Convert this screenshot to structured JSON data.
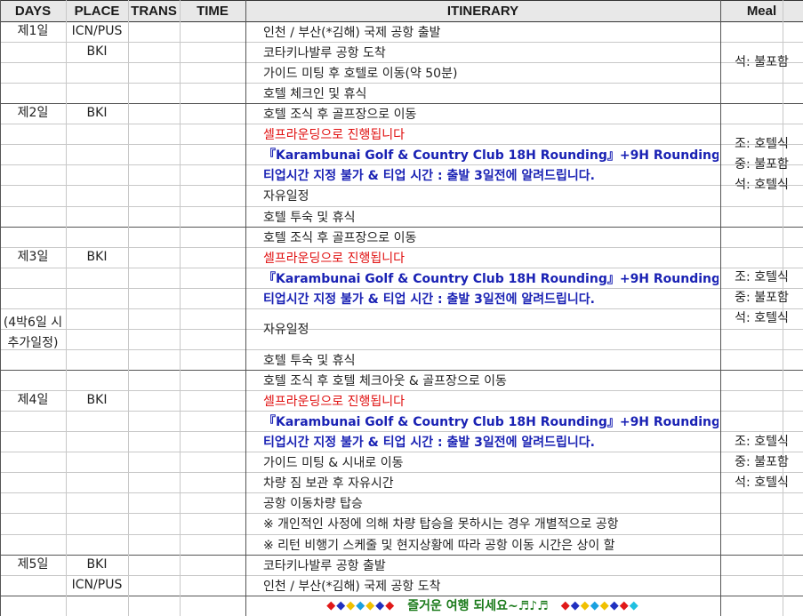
{
  "headers": {
    "days": "DAYS",
    "place": "PLACE",
    "trans": "TRANS",
    "time": "TIME",
    "itinerary": "ITINERARY",
    "meal": "Meal"
  },
  "days": [
    {
      "day_label": "제1일",
      "places": [
        "ICN/PUS",
        "BKI"
      ],
      "itinerary": [
        {
          "text": "인천 / 부산(*김해) 국제 공항 출발",
          "style": "normal"
        },
        {
          "text": "코타키나발루 공항 도착",
          "style": "normal"
        },
        {
          "text": "가이드 미팅 후 호텔로 이동(약 50분)",
          "style": "normal"
        },
        {
          "text": "호텔 체크인 및 휴식",
          "style": "normal"
        }
      ],
      "meals": [
        "석: 불포함"
      ]
    },
    {
      "day_label": "제2일",
      "places": [
        "BKI"
      ],
      "itinerary": [
        {
          "text": "호텔 조식 후 골프장으로 이동",
          "style": "normal"
        },
        {
          "text": "셀프라운딩으로 진행됩니다",
          "style": "red"
        },
        {
          "text": "『Karambunai Golf & Country Club 18H Rounding』+9H Rounding",
          "style": "blue"
        },
        {
          "text": "티업시간 지정 불가 & 티업 시간 : 출발 3일전에 알려드립니다.",
          "style": "blue"
        },
        {
          "text": "자유일정",
          "style": "normal"
        },
        {
          "text": "호텔 투숙 및 휴식",
          "style": "normal"
        }
      ],
      "meals": [
        "조: 호텔식",
        "중: 불포함",
        "석: 호텔식"
      ]
    },
    {
      "day_label": "제3일",
      "note": "(4박6일 시 추가일정)",
      "places": [
        "BKI"
      ],
      "itinerary": [
        {
          "text": "호텔 조식 후 골프장으로 이동",
          "style": "normal"
        },
        {
          "text": "셀프라운딩으로 진행됩니다",
          "style": "red"
        },
        {
          "text": "『Karambunai Golf & Country Club 18H Rounding』+9H Rounding",
          "style": "blue"
        },
        {
          "text": "티업시간 지정 불가 & 티업 시간 : 출발 3일전에 알려드립니다.",
          "style": "blue"
        },
        {
          "text": "자유일정",
          "style": "normal"
        },
        {
          "text": "호텔 투숙 및 휴식",
          "style": "normal"
        }
      ],
      "meals": [
        "조: 호텔식",
        "중: 불포함",
        "석: 호텔식"
      ]
    },
    {
      "day_label": "제4일",
      "places": [
        "BKI"
      ],
      "itinerary": [
        {
          "text": "호텔 조식 후 호텔 체크아웃 & 골프장으로 이동",
          "style": "normal"
        },
        {
          "text": "셀프라운딩으로 진행됩니다",
          "style": "red"
        },
        {
          "text": "『Karambunai Golf & Country Club 18H Rounding』+9H Rounding",
          "style": "blue"
        },
        {
          "text": "티업시간 지정 불가 & 티업 시간 : 출발 3일전에 알려드립니다.",
          "style": "blue"
        },
        {
          "text": "가이드 미팅 & 시내로 이동",
          "style": "normal"
        },
        {
          "text": "차량 짐 보관 후 자유시간",
          "style": "normal"
        },
        {
          "text": "공항 이동차량 탑승",
          "style": "normal"
        },
        {
          "text": " ※ 개인적인 사정에 의해 차량 탑승을 못하시는 경우 개별적으로 공항",
          "style": "note"
        },
        {
          "text": " ※ 리턴 비행기 스케줄 및 현지상황에 따라 공항 이동 시간은 상이 할",
          "style": "note"
        }
      ],
      "meals": [
        "조: 호텔식",
        "중: 불포함",
        "석: 호텔식"
      ]
    },
    {
      "day_label": "제5일",
      "places": [
        "BKI",
        "ICN/PUS"
      ],
      "itinerary": [
        {
          "text": "코타키나발루 공항 출발",
          "style": "normal"
        },
        {
          "text": "인천 / 부산(*김해) 국제 공항 도착",
          "style": "normal"
        }
      ],
      "meals": []
    }
  ],
  "footer": {
    "left_diamonds": "◆◆◆◆◆◆◆",
    "message": "즐거운 여행 되세요~♬♪♬",
    "right_diamonds": "◆◆◆◆◆◆◆◆"
  },
  "colors": {
    "header_bg": "#e8e8e8",
    "grid": "#c8c8c8",
    "border_dark": "#333333",
    "red_text": "#e01010",
    "blue_text": "#1a22b4",
    "green_text": "#1a7a1a"
  }
}
